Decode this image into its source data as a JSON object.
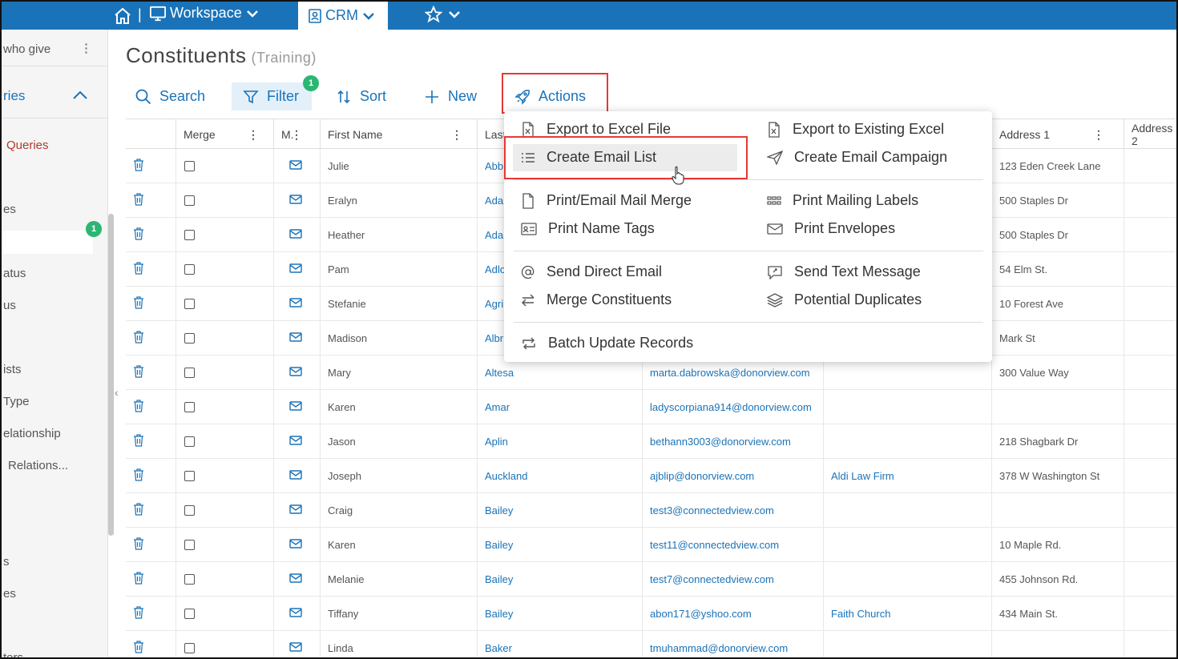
{
  "topbar": {
    "workspace_label": "Workspace",
    "crm_label": "CRM"
  },
  "sidebar": {
    "items": [
      "who give",
      "ries",
      "Queries",
      "es",
      "atus",
      "us",
      "ists",
      "Type",
      "elationship",
      "Relations...",
      "s",
      "es",
      "ters"
    ],
    "badge": "1"
  },
  "page": {
    "title": "Constituents",
    "subtitle": "(Training)"
  },
  "toolbar": {
    "search_label": "Search",
    "filter_label": "Filter",
    "filter_badge": "1",
    "sort_label": "Sort",
    "new_label": "New",
    "actions_label": "Actions"
  },
  "table": {
    "headers": [
      "Merge",
      "M.",
      "First Name",
      "Last",
      "Address 1",
      "Address 2"
    ],
    "rows": [
      {
        "first": "Julie",
        "last": "Abb",
        "email": "",
        "company": "",
        "address": "123 Eden Creek Lane"
      },
      {
        "first": "Eralyn",
        "last": "Adan",
        "email": "",
        "company": "",
        "address": "500 Staples Dr"
      },
      {
        "first": "Heather",
        "last": "Adan",
        "email": "",
        "company": "",
        "address": "500 Staples Dr"
      },
      {
        "first": "Pam",
        "last": "Adlo",
        "email": "",
        "company": "",
        "address": "54 Elm St."
      },
      {
        "first": "Stefanie",
        "last": "Agri",
        "email": "",
        "company": "",
        "address": "10 Forest Ave"
      },
      {
        "first": "Madison",
        "last": "Albri",
        "email": "",
        "company": "",
        "address": "Mark St"
      },
      {
        "first": "Mary",
        "last": "Altesa",
        "email": "marta.dabrowska@donorview.com",
        "company": "",
        "address": "300 Value Way"
      },
      {
        "first": "Karen",
        "last": "Amar",
        "email": "ladyscorpiana914@donorview.com",
        "company": "",
        "address": ""
      },
      {
        "first": "Jason",
        "last": "Aplin",
        "email": "bethann3003@donorview.com",
        "company": "",
        "address": "218 Shagbark Dr"
      },
      {
        "first": "Joseph",
        "last": "Auckland",
        "email": "ajblip@donorview.com",
        "company": "Aldi Law Firm",
        "address": "378 W Washington St"
      },
      {
        "first": "Craig",
        "last": "Bailey",
        "email": "test3@connectedview.com",
        "company": "",
        "address": ""
      },
      {
        "first": "Karen",
        "last": "Bailey",
        "email": "test11@connectedview.com",
        "company": "",
        "address": "10 Maple Rd."
      },
      {
        "first": "Melanie",
        "last": "Bailey",
        "email": "test7@connectedview.com",
        "company": "",
        "address": "455 Johnson Rd."
      },
      {
        "first": "Tiffany",
        "last": "Bailey",
        "email": "abon171@yshoo.com",
        "company": "Faith Church",
        "address": "434 Main St."
      },
      {
        "first": "Linda",
        "last": "Baker",
        "email": "tmuhammad@donorview.com",
        "company": "",
        "address": ""
      }
    ]
  },
  "actions_menu": {
    "left": [
      "Export to Excel File",
      "Create Email List",
      "Print/Email Mail Merge",
      "Print Name Tags",
      "Send Direct Email",
      "Merge Constituents",
      "Batch Update Records"
    ],
    "right": [
      "Export to Existing Excel",
      "Create Email Campaign",
      "Print Mailing Labels",
      "Print Envelopes",
      "Send Text Message",
      "Potential Duplicates"
    ]
  },
  "colors": {
    "brand": "#1a73b8",
    "badge": "#2bb673",
    "highlight": "#e53935"
  }
}
